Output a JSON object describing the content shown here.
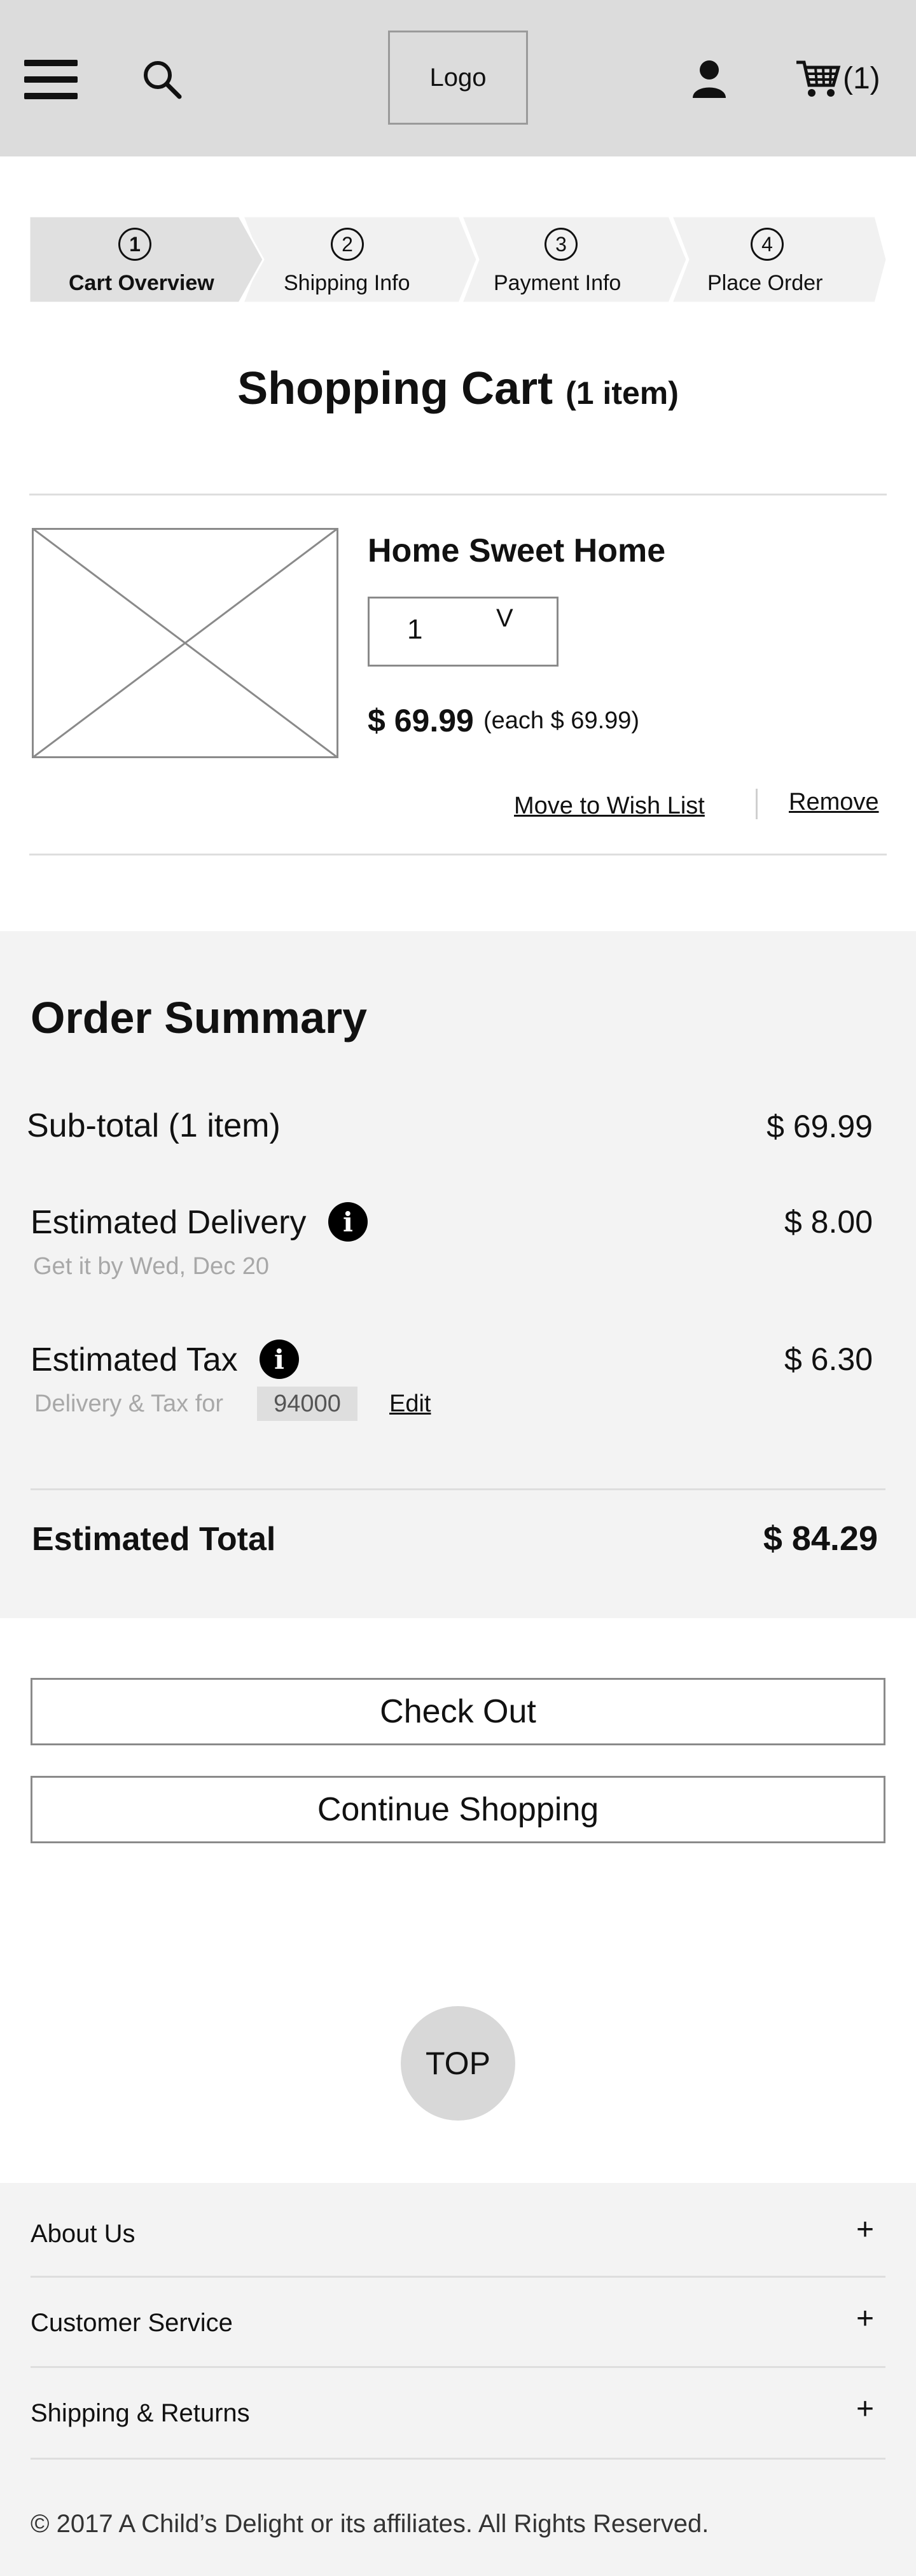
{
  "header": {
    "logo_text": "Logo",
    "cart_count": "(1)",
    "icons": [
      "menu-icon",
      "search-icon",
      "account-icon",
      "cart-icon"
    ]
  },
  "steps": [
    {
      "number": "1",
      "label": "Cart Overview",
      "active": true
    },
    {
      "number": "2",
      "label": "Shipping Info",
      "active": false
    },
    {
      "number": "3",
      "label": "Payment Info",
      "active": false
    },
    {
      "number": "4",
      "label": "Place Order",
      "active": false
    }
  ],
  "page": {
    "title": "Shopping Cart",
    "item_count": "(1 item)"
  },
  "cart_item": {
    "name": "Home Sweet Home",
    "quantity": "1",
    "quantity_chevron": "V",
    "price": "$ 69.99",
    "price_each": "(each $ 69.99)",
    "wish_list_label": "Move to Wish List",
    "remove_label": "Remove"
  },
  "summary": {
    "title": "Order Summary",
    "subtotal_label": "Sub-total (1 item)",
    "subtotal_value": "$ 69.99",
    "delivery_label": "Estimated Delivery",
    "delivery_value": "$ 8.00",
    "delivery_note": "Get it by Wed, Dec 20",
    "tax_label": "Estimated Tax",
    "tax_value": "$ 6.30",
    "tax_note": "Delivery & Tax for",
    "zip": "94000",
    "edit_label": "Edit",
    "total_label": "Estimated Total",
    "total_value": "$ 84.29",
    "info_glyph": "i"
  },
  "buttons": {
    "checkout": "Check Out",
    "continue": "Continue Shopping",
    "top": "TOP"
  },
  "footer": {
    "sections": [
      "About Us",
      "Customer Service",
      "Shipping & Returns"
    ],
    "expand_glyph": "+",
    "copyright": "© 2017 A Child’s Delight or its affiliates. All Rights Reserved."
  },
  "colors": {
    "header_bg": "#dcdcdc",
    "active_step_bg": "#e0e0e0",
    "step_bg": "#f1f1f1",
    "summary_bg": "#f3f3f3",
    "muted_text": "#a8a8a8"
  }
}
